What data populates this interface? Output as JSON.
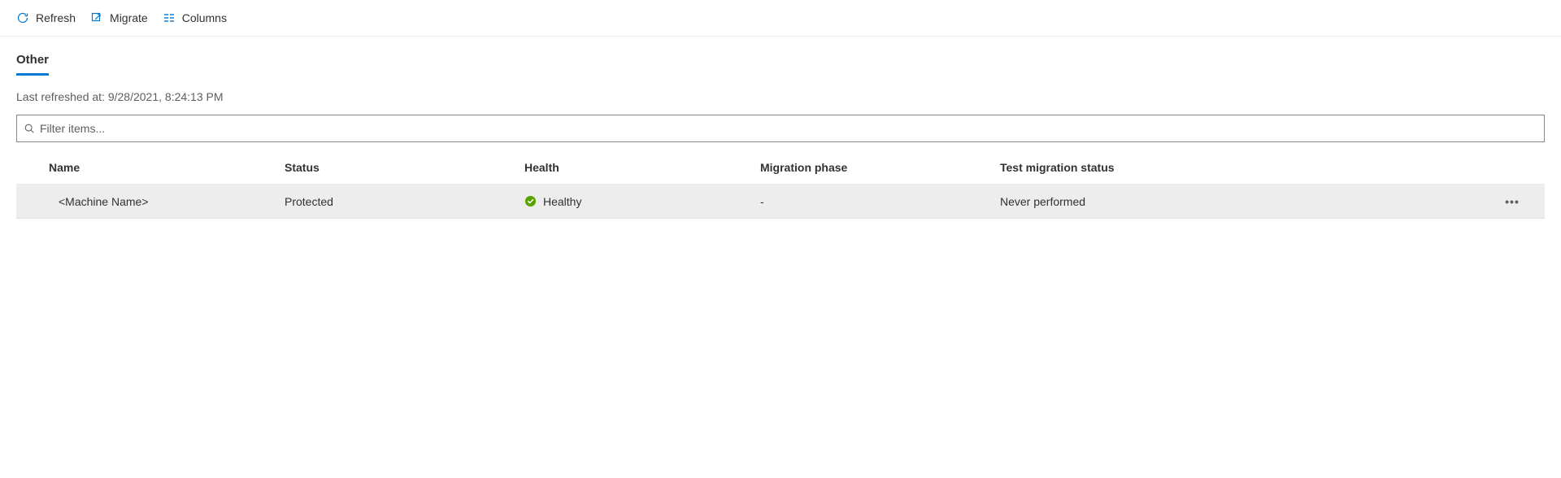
{
  "toolbar": {
    "refresh_label": "Refresh",
    "migrate_label": "Migrate",
    "columns_label": "Columns"
  },
  "tabs": {
    "active": "Other"
  },
  "refresh_info": {
    "prefix": "Last refreshed at: ",
    "timestamp": "9/28/2021, 8:24:13 PM"
  },
  "filter": {
    "placeholder": "Filter items..."
  },
  "table": {
    "headers": {
      "name": "Name",
      "status": "Status",
      "health": "Health",
      "migration_phase": "Migration phase",
      "test_migration_status": "Test migration status"
    },
    "rows": [
      {
        "name": "<Machine Name>",
        "status": "Protected",
        "health": "Healthy",
        "health_state": "ok",
        "migration_phase": "-",
        "test_migration_status": "Never performed"
      }
    ]
  }
}
